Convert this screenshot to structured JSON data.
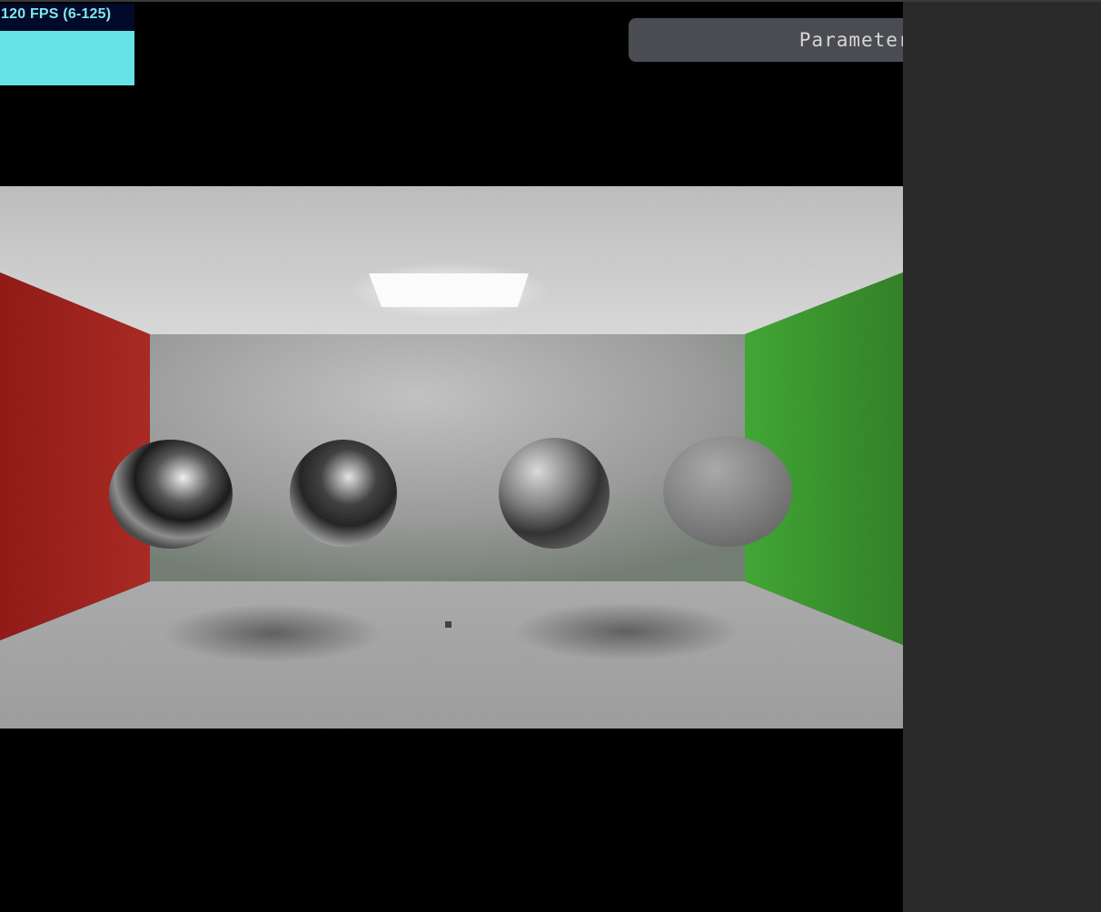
{
  "stats": {
    "fps_label": "120 FPS (6-125)",
    "graph_color": "#66e3e6",
    "text_color": "#7fe8f0"
  },
  "params_panel": {
    "title": "Parameters",
    "toggle_icon": "collapse-toggle-icon"
  },
  "scene": {
    "description_colors": {
      "left_wall": "#9a1a14",
      "right_wall": "#2c8a22",
      "back_wall": "#9c9c9c",
      "ceiling": "#cfcfcf",
      "floor": "#a8a8a8",
      "light": "#ffffff"
    }
  }
}
